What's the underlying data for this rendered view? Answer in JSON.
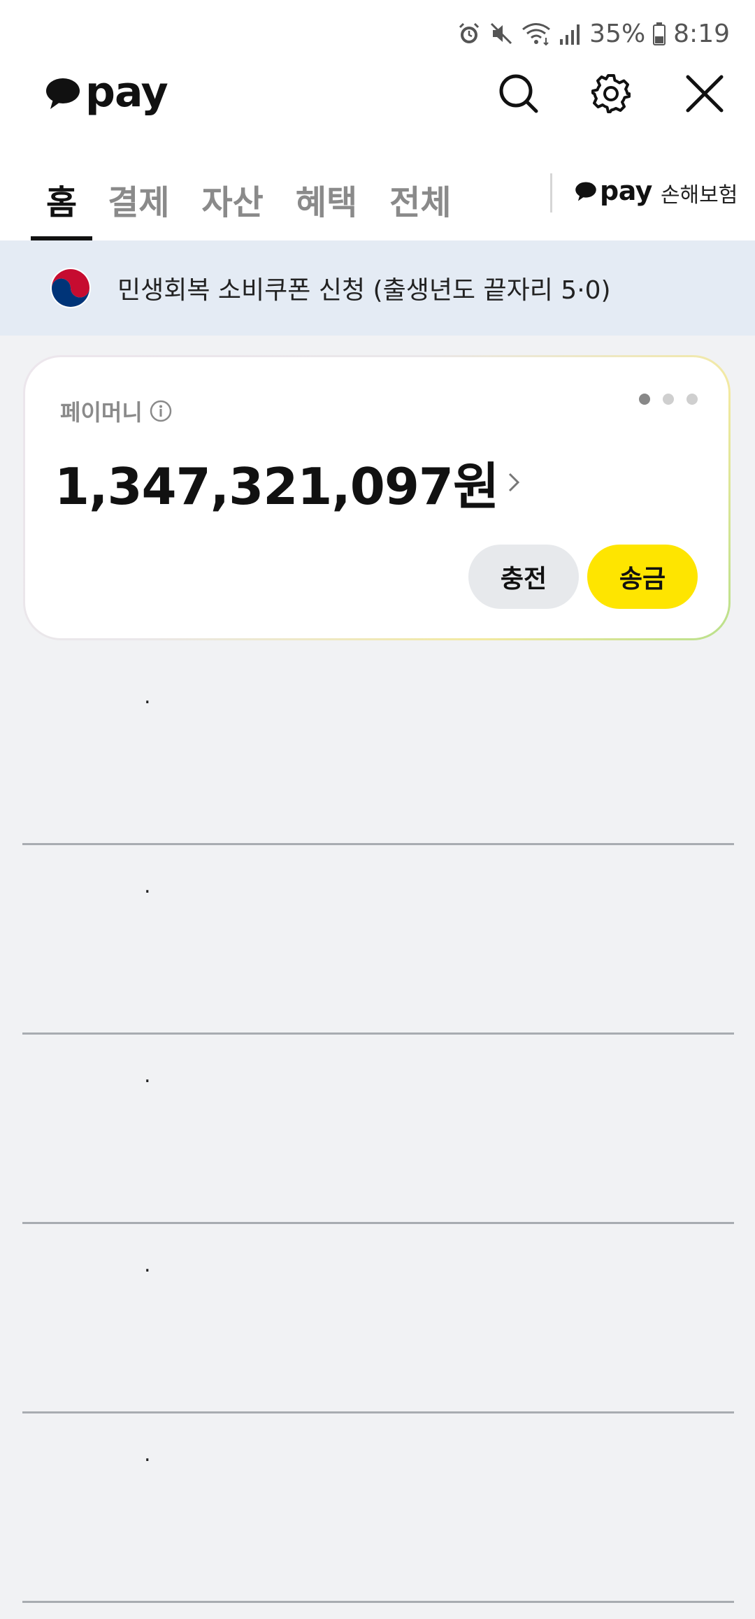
{
  "status_bar": {
    "battery": "35%",
    "time": "8:19",
    "icons": [
      "alarm-icon",
      "mute-icon",
      "wifi-icon",
      "signal-icon",
      "battery-icon"
    ]
  },
  "header": {
    "logo_text": "pay",
    "icons": [
      "search-icon",
      "gear-icon",
      "close-icon"
    ]
  },
  "tabs": [
    {
      "label": "홈",
      "active": true
    },
    {
      "label": "결제",
      "active": false
    },
    {
      "label": "자산",
      "active": false
    },
    {
      "label": "혜택",
      "active": false
    },
    {
      "label": "전체",
      "active": false
    }
  ],
  "insurance": {
    "logo_text": "pay",
    "label": "손해보험"
  },
  "banner": {
    "text": "민생회복 소비쿠폰 신청 (출생년도 끝자리 5·0)",
    "icon": "korea-emblem-icon"
  },
  "card": {
    "label": "페이머니",
    "balance": "1,347,321,097원",
    "page_indicator": {
      "count": 3,
      "active_index": 0
    },
    "charge_label": "충전",
    "send_label": "송금",
    "colors": {
      "send": "#fee500",
      "charge": "#e7e9ec"
    }
  },
  "list": {
    "items": [
      {
        "text": "."
      },
      {
        "text": "."
      },
      {
        "text": "."
      },
      {
        "text": "."
      },
      {
        "text": "."
      }
    ]
  }
}
